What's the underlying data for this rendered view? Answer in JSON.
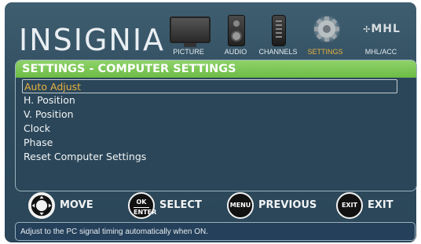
{
  "header": {
    "logo": "INSIGNIA",
    "nav": [
      {
        "label": "PICTURE",
        "icon": "tv-icon"
      },
      {
        "label": "AUDIO",
        "icon": "speaker-icon"
      },
      {
        "label": "CHANNELS",
        "icon": "remote-icon"
      },
      {
        "label": "SETTINGS",
        "icon": "gear-icon",
        "active": true
      },
      {
        "label": "MHL/ACC",
        "icon": "mhl-logo",
        "logo_text": "MHL"
      }
    ]
  },
  "content": {
    "title": "SETTINGS - COMPUTER SETTINGS",
    "items": [
      {
        "label": "Auto Adjust",
        "selected": true
      },
      {
        "label": "H. Position"
      },
      {
        "label": "V. Position"
      },
      {
        "label": "Clock"
      },
      {
        "label": "Phase"
      },
      {
        "label": "Reset Computer Settings"
      }
    ]
  },
  "legend": {
    "move": {
      "label": "MOVE",
      "icon": "dpad-icon"
    },
    "select": {
      "key_line1": "OK",
      "key_line2": "ENTER",
      "label": "SELECT"
    },
    "previous": {
      "key": "MENU",
      "label": "PREVIOUS"
    },
    "exit": {
      "key": "EXIT",
      "label": "EXIT"
    }
  },
  "help_text": "Adjust to the PC signal timing automatically when ON.",
  "colors": {
    "panel_bg": "#2f4c5e",
    "title_bar": "#6cbb46",
    "selected_text": "#e9b13e",
    "active_nav": "#e8b13a"
  }
}
